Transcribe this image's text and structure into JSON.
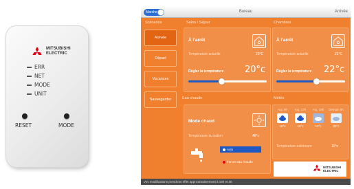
{
  "device": {
    "brand_line1": "MITSUBISHI",
    "brand_line2": "ELECTRIC",
    "leds": [
      "ERR",
      "NET",
      "MODE",
      "UNIT"
    ],
    "buttons": [
      "RESET",
      "MODE"
    ]
  },
  "app": {
    "toggle_label": "Marche",
    "title": "Bureau",
    "top_right": "Arrivée",
    "sections": {
      "scenario": "Scénarios",
      "left_zone": "Salon / Séjour",
      "right_zone": "Chambres",
      "hot_water": "Eau chaude",
      "weather": "Météo"
    },
    "nav": [
      {
        "label": "Arrivée",
        "active": true
      },
      {
        "label": "Départ",
        "active": false
      },
      {
        "label": "Vacances",
        "active": false
      },
      {
        "label": "Sauvegarder",
        "active": false
      }
    ],
    "zone_left": {
      "status": "À l'arrêt",
      "room_label": "Température actuelle",
      "room_value": "20°C",
      "set_label": "Régler la température",
      "set_value": "20°c",
      "level": 0.42
    },
    "zone_right": {
      "status": "À l'arrêt",
      "room_label": "Température actuelle",
      "room_value": "22°C",
      "set_label": "Régler la température",
      "set_value": "22°c",
      "level": 0.58
    },
    "hot_water_card": {
      "mode": "Mode chaud",
      "tank_label": "Température du ballon",
      "tank_value": "48°c",
      "option_auto": "Auto",
      "option_boost": "Forcer eau chaude"
    },
    "forecast": {
      "days": [
        "Auj. 9h",
        "Auj. 12h",
        "Auj. 18h",
        "Demain 8h"
      ],
      "temps": [
        "16°c",
        "16°c",
        "12°c",
        "22°c"
      ],
      "outdoor_label": "Température extérieure",
      "outdoor_value": "16°c"
    },
    "footer": "Vos modifications prendront effet approximativement à 19h et 30",
    "colors": {
      "accent": "#f07f2e",
      "slider": "#1e58c2",
      "brand_red": "#e60012"
    }
  }
}
